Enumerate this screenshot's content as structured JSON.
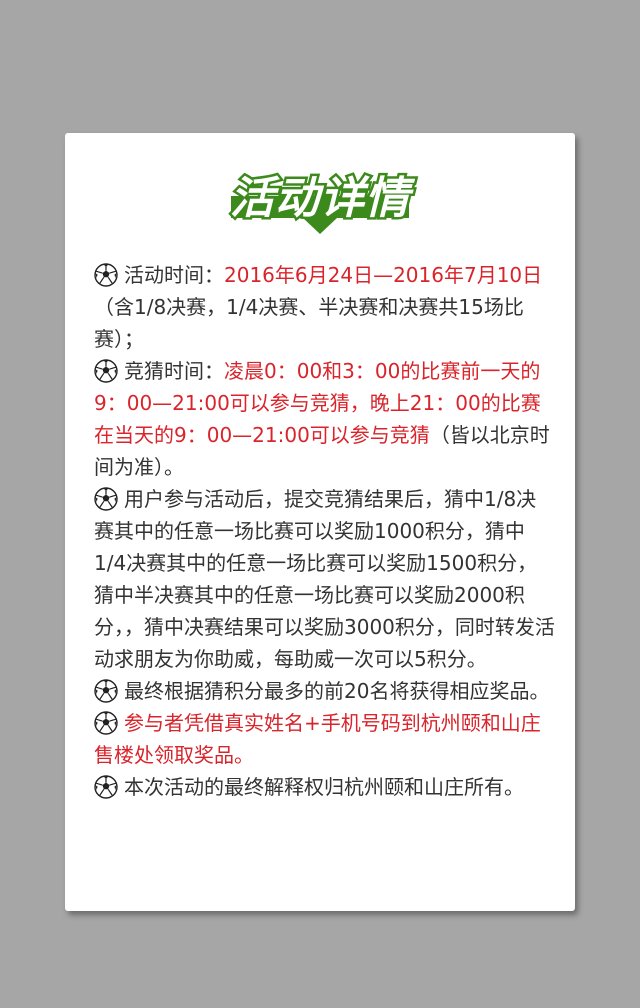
{
  "title": "活动详情",
  "colors": {
    "background": "#a6a6a6",
    "card": "#ffffff",
    "accent_green": "#3c8a1c",
    "highlight_red": "#d9242b",
    "text": "#333333"
  },
  "items": [
    {
      "icon": "soccer-ball-icon",
      "label": "活动时间：",
      "highlight": "2016年6月24日—2016年7月10日",
      "rest": "（含1/8决赛，1/4决赛、半决赛和决赛共15场比赛）；"
    },
    {
      "icon": "soccer-ball-icon",
      "label": "竞猜时间：",
      "highlight": "凌晨0：00和3：00的比赛前一天的9：00—21:00可以参与竞猜，晚上21：00的比赛在当天的9：00—21:00可以参与竞猜",
      "rest": "（皆以北京时间为准）。"
    },
    {
      "icon": "soccer-ball-icon",
      "label": "",
      "highlight": "",
      "rest": "用户参与活动后，提交竞猜结果后，猜中1/8决赛其中的任意一场比赛可以奖励1000积分，猜中1/4决赛其中的任意一场比赛可以奖励1500积分，猜中半决赛其中的任意一场比赛可以奖励2000积分，，猜中决赛结果可以奖励3000积分，同时转发活动求朋友为你助威，每助威一次可以5积分。"
    },
    {
      "icon": "soccer-ball-icon",
      "label": "",
      "highlight": "",
      "rest": "最终根据猜积分最多的前20名将获得相应奖品。"
    },
    {
      "icon": "soccer-ball-icon",
      "label": "",
      "highlight": "参与者凭借真实姓名+手机号码到杭州颐和山庄售楼处领取奖品。",
      "rest": ""
    },
    {
      "icon": "soccer-ball-icon",
      "label": "",
      "highlight": "",
      "rest": "本次活动的最终解释权归杭州颐和山庄所有。"
    }
  ]
}
